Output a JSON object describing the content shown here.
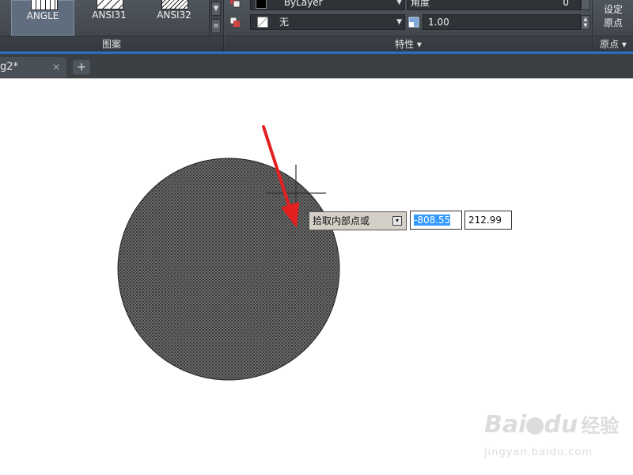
{
  "ribbon": {
    "patterns": [
      {
        "label": "ANGLE",
        "selected": true
      },
      {
        "label": "ANSI31",
        "selected": false
      },
      {
        "label": "ANSI32",
        "selected": false
      }
    ],
    "pattern_panel_title": "图案",
    "properties": {
      "color_value": "ByLayer",
      "bg_color_value": "无",
      "angle_label": "角度",
      "angle_value": "0",
      "scale_value": "1.00",
      "panel_title": "特性 ▾"
    },
    "origin": {
      "set_origin_label_1": "设定",
      "set_origin_label_2": "原点",
      "panel_title": "原点 ▾"
    }
  },
  "tabs": {
    "doc_tab_label": "g2*",
    "new_tab_symbol": "+"
  },
  "canvas": {
    "prompt_text": "拾取内部点或",
    "x_value_selected": "-808.55",
    "y_value": "212.99"
  },
  "watermark": {
    "brand": "Bai",
    "brand2": "du",
    "cn": "经验",
    "url": "jingyan.baidu.com"
  },
  "colors": {
    "accent_blue": "#2a6fc2",
    "annotation_arrow": "#e32020",
    "hatch_fill": "#5a5a5a"
  }
}
